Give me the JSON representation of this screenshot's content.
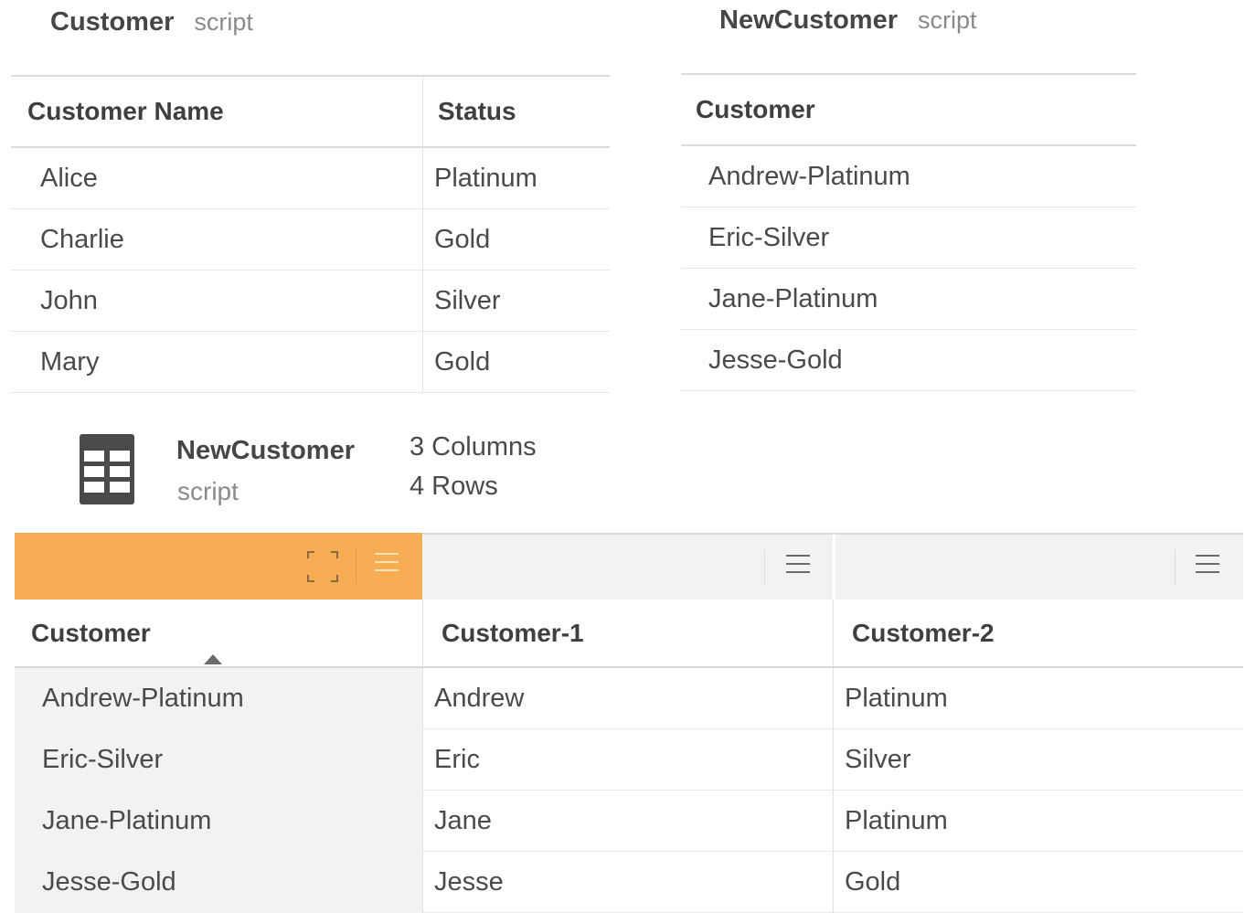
{
  "customer_table": {
    "title": "Customer",
    "subtitle": "script",
    "headers": [
      "Customer Name",
      "Status"
    ],
    "rows": [
      [
        "Alice",
        "Platinum"
      ],
      [
        "Charlie",
        "Gold"
      ],
      [
        "John",
        "Silver"
      ],
      [
        "Mary",
        "Gold"
      ]
    ]
  },
  "newcustomer_table": {
    "title": "NewCustomer",
    "subtitle": "script",
    "header": "Customer",
    "rows": [
      "Andrew-Platinum",
      "Eric-Silver",
      "Jane-Platinum",
      "Jesse-Gold"
    ]
  },
  "info": {
    "icon": "table-icon",
    "name": "NewCustomer",
    "subtitle": "script",
    "columns": "3 Columns",
    "rows": "4 Rows"
  },
  "preview_table": {
    "accent_color": "#f6ad53",
    "headers": [
      "Customer",
      "Customer-1",
      "Customer-2"
    ],
    "rows": [
      [
        "Andrew-Platinum",
        "Andrew",
        "Platinum"
      ],
      [
        "Eric-Silver",
        "Eric",
        "Silver"
      ],
      [
        "Jane-Platinum",
        "Jane",
        "Platinum"
      ],
      [
        "Jesse-Gold",
        "Jesse",
        "Gold"
      ]
    ]
  }
}
